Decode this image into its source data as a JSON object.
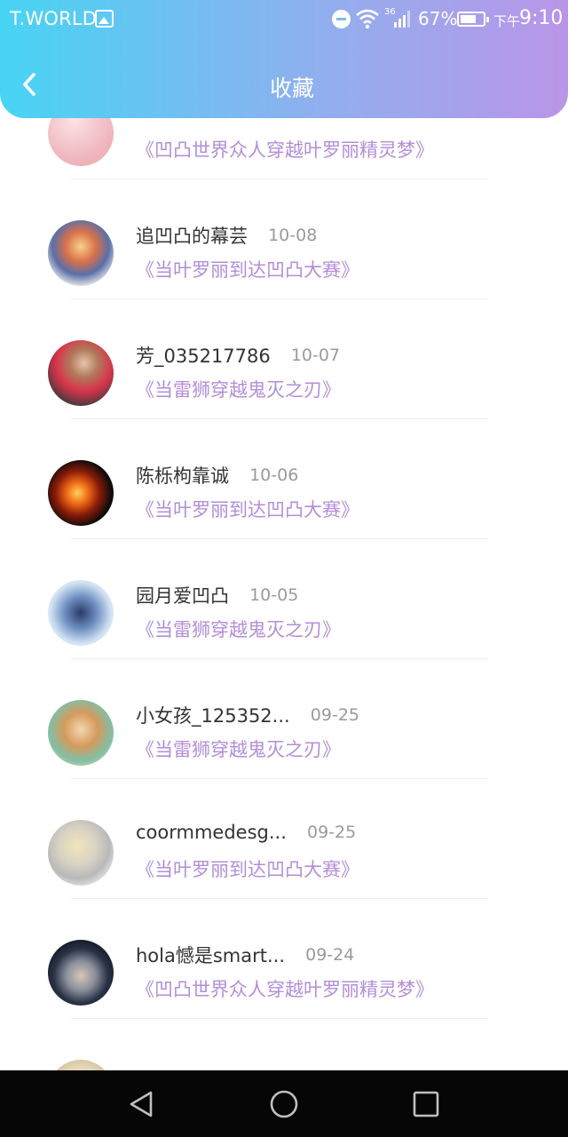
{
  "status_bar": {
    "carrier": "T.WORLD",
    "network": "36",
    "battery": "67%",
    "clock_prefix": "下午",
    "clock_time": "9:10"
  },
  "header": {
    "title": "收藏",
    "back_icon": "chevron-left-icon",
    "accent_start": "#47d4f4",
    "accent_end": "#b995e8"
  },
  "favorites": [
    {
      "name": "",
      "date": "",
      "title": "《凹凸世界众人穿越叶罗丽精灵梦》"
    },
    {
      "name": "追凹凸的幕芸",
      "date": "10-08",
      "title": "《当叶罗丽到达凹凸大赛》"
    },
    {
      "name": "芳_035217786",
      "date": "10-07",
      "title": "《当雷狮穿越鬼灭之刃》"
    },
    {
      "name": "陈栎枸靠诚",
      "date": "10-06",
      "title": "《当叶罗丽到达凹凸大赛》"
    },
    {
      "name": "园月爱凹凸",
      "date": "10-05",
      "title": "《当雷狮穿越鬼灭之刃》"
    },
    {
      "name": "小女孩_125352...",
      "date": "09-25",
      "title": "《当雷狮穿越鬼灭之刃》"
    },
    {
      "name": "coormmedesg...",
      "date": "09-25",
      "title": "《当叶罗丽到达凹凸大赛》"
    },
    {
      "name": "hola憾是smart...",
      "date": "09-24",
      "title": "《凹凸世界众人穿越叶罗丽精灵梦》"
    }
  ],
  "colors": {
    "name": "#333333",
    "date": "#9a9a9a",
    "title_link": "#b38ed8"
  },
  "nav": {
    "back_icon": "triangle-back-icon",
    "home_icon": "circle-home-icon",
    "recents_icon": "square-recents-icon"
  }
}
